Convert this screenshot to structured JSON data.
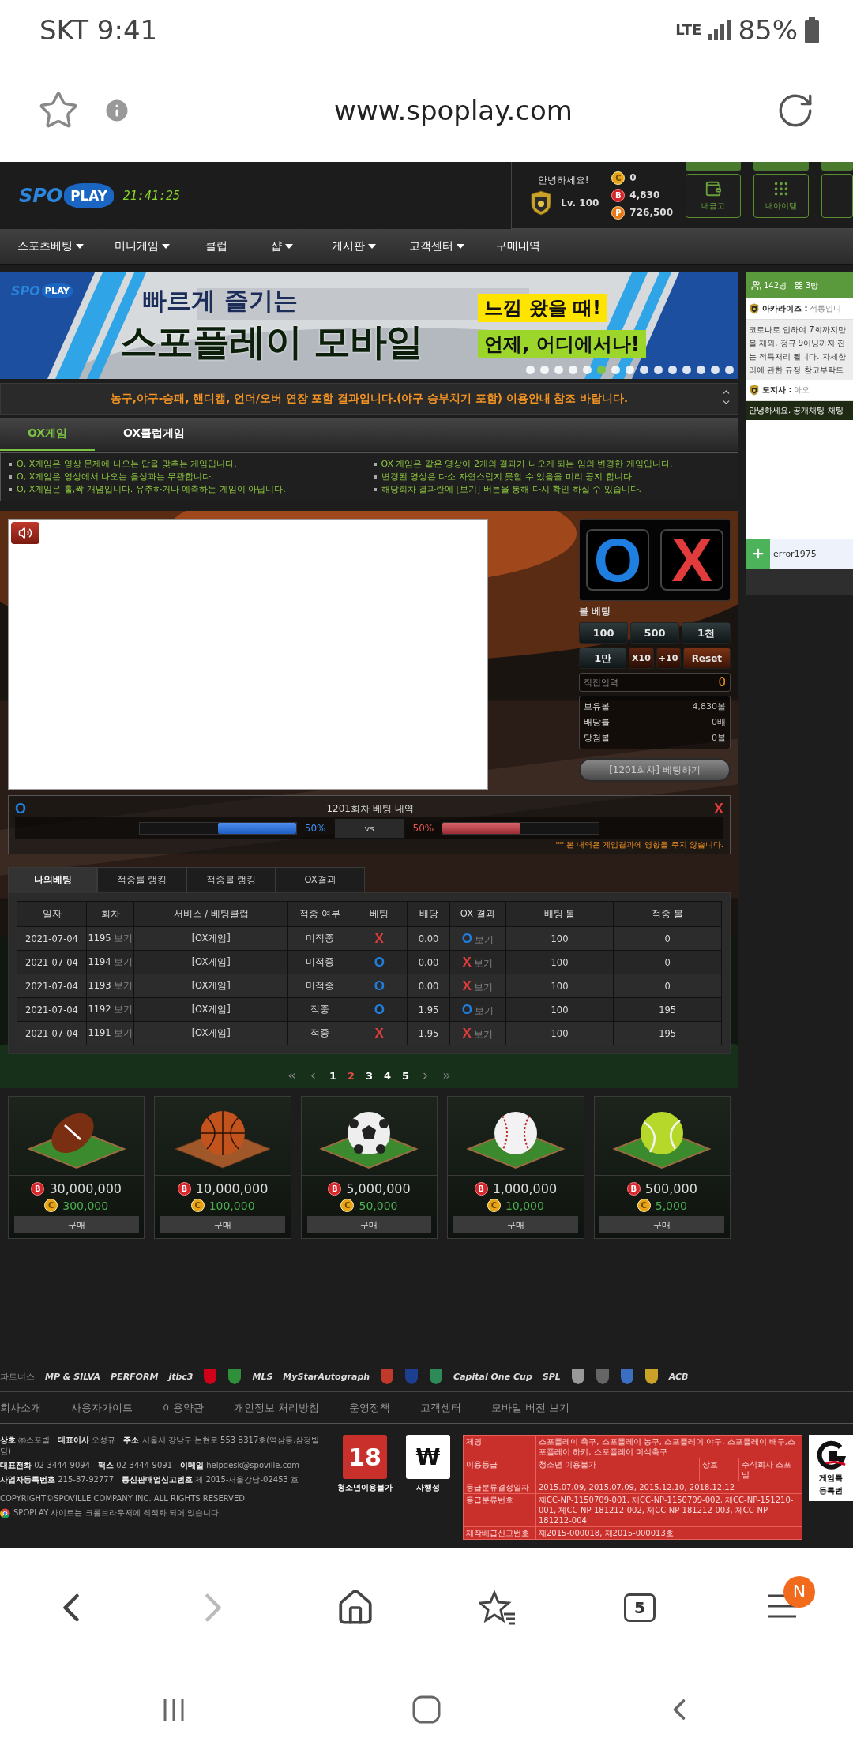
{
  "status_bar": {
    "carrier_time": "SKT 9:41",
    "network": "LTE",
    "battery": "85%"
  },
  "browser": {
    "url": "www.spoplay.com",
    "forward_disabled": true,
    "open_tabs": "5",
    "menu_badge": "N"
  },
  "header": {
    "logo": {
      "part_1": "SPO",
      "part_2": "PLAY"
    },
    "clock": "21:41:25",
    "greeting": "안녕하세요!",
    "level": "Lv. 100",
    "balances": [
      {
        "kind": "coin",
        "symbol": "C",
        "value": "0"
      },
      {
        "kind": "ball",
        "symbol": "B",
        "value": "4,830"
      },
      {
        "kind": "point",
        "symbol": "P",
        "value": "726,500"
      }
    ],
    "buttons": [
      {
        "kind": "wallet",
        "label": "내금고"
      },
      {
        "kind": "items",
        "label": "내아이템"
      }
    ]
  },
  "nav": [
    {
      "label": "스포츠베팅",
      "dropdown": true
    },
    {
      "label": "미니게임",
      "dropdown": true
    },
    {
      "label": "클럽",
      "dropdown": false
    },
    {
      "label": "샵",
      "dropdown": true
    },
    {
      "label": "게시판",
      "dropdown": true
    },
    {
      "label": "고객센터",
      "dropdown": true
    },
    {
      "label": "구매내역",
      "dropdown": false
    }
  ],
  "banner": {
    "logo": {
      "part_1": "SPO",
      "part_2": "PLAY"
    },
    "line_1": "빠르게 즐기는",
    "line_2": "스포플레이 모바일",
    "tag_1": "느낌 왔을 때!",
    "tag_2": "언제, 어디에서나!",
    "dots": [
      {
        "selected": false
      },
      {
        "selected": false
      },
      {
        "selected": false
      },
      {
        "selected": false
      },
      {
        "selected": false
      },
      {
        "selected": true
      },
      {
        "selected": false
      },
      {
        "selected": false
      },
      {
        "selected": false
      },
      {
        "selected": false
      },
      {
        "selected": false
      },
      {
        "selected": false
      },
      {
        "selected": false
      },
      {
        "selected": false
      },
      {
        "selected": false
      }
    ]
  },
  "notice": "농구,야구-승패, 핸디캡, 언더/오버 연장 포함 결과입니다.(야구 승부치기 포함) 이용안내 참조 바랍니다.",
  "game_tabs": [
    {
      "label": "OX게임",
      "selected": true
    },
    {
      "label": "OX클럽게임",
      "selected": false
    }
  ],
  "rules": {
    "left": [
      "O, X게임은 영상 문제에 나오는 답을 맞추는 게임입니다.",
      "O, X게임은 영상에서 나오는 음성과는 무관합니다.",
      "O, X게임은 홀,짝 개념입니다. 유추하거나 예측하는 게임이 아닙니다."
    ],
    "right": [
      "OX 게임은 같은 영상이 2개의 결과가 나오게 되는 임의 변경한 게임입니다.",
      "변경된 영상은 다소 자연스럽지 못할 수 있음을 미리 공지 합니다.",
      "해당회차 결과란에 [보기] 버튼을 통해 다시 확인 하실 수 있습니다."
    ]
  },
  "bet_panel": {
    "choices": [
      {
        "kind": "o",
        "label": "O"
      },
      {
        "kind": "x",
        "label": "X"
      }
    ],
    "title": "볼 베팅",
    "chips": [
      {
        "kind": "amount",
        "label": "100"
      },
      {
        "kind": "amount",
        "label": "500"
      },
      {
        "kind": "amount",
        "label": "1천"
      },
      {
        "kind": "amount",
        "label": "1만"
      },
      {
        "kind": "modifier",
        "label": "X10"
      },
      {
        "kind": "modifier",
        "label": "÷10"
      },
      {
        "kind": "reset",
        "label": "Reset"
      }
    ],
    "direct_input": {
      "label": "직접입력",
      "value": "0"
    },
    "stats": [
      {
        "label": "보유볼",
        "value": "4,830볼"
      },
      {
        "label": "배당률",
        "value": "0배"
      },
      {
        "label": "당첨볼",
        "value": "0볼"
      }
    ],
    "submit": "[1201회차] 베팅하기"
  },
  "history": {
    "title": "1201회차 베팅 내역",
    "left": {
      "label": "O",
      "percent": "50%",
      "level": 0.5
    },
    "vs": "vs",
    "right": {
      "label": "X",
      "percent": "50%",
      "level": 0.5
    },
    "note": "** 본 내역은 게임결과에 영향을 주지 않습니다."
  },
  "record_tabs": [
    {
      "label": "나의베팅",
      "selected": true
    },
    {
      "label": "적중률 랭킹",
      "selected": false
    },
    {
      "label": "적중볼 랭킹",
      "selected": false
    },
    {
      "label": "OX결과",
      "selected": false
    }
  ],
  "table": {
    "columns": [
      "일자",
      "회차",
      "서비스 / 베팅클럽",
      "적중 여부",
      "베팅",
      "배당",
      "OX 결과",
      "배팅 볼",
      "적중 볼"
    ],
    "rows": [
      {
        "date": "2021-07-04",
        "round": "1195",
        "view": "보기",
        "service": "[OX게임]",
        "hit": "미적중",
        "bet": {
          "kind": "x",
          "label": "X"
        },
        "odds": "0.00",
        "result": {
          "kind": "o",
          "label": "O"
        },
        "result_view": "보기",
        "bet_ball": "100",
        "won_ball": "0"
      },
      {
        "date": "2021-07-04",
        "round": "1194",
        "view": "보기",
        "service": "[OX게임]",
        "hit": "미적중",
        "bet": {
          "kind": "o",
          "label": "O"
        },
        "odds": "0.00",
        "result": {
          "kind": "x",
          "label": "X"
        },
        "result_view": "보기",
        "bet_ball": "100",
        "won_ball": "0"
      },
      {
        "date": "2021-07-04",
        "round": "1193",
        "view": "보기",
        "service": "[OX게임]",
        "hit": "미적중",
        "bet": {
          "kind": "o",
          "label": "O"
        },
        "odds": "0.00",
        "result": {
          "kind": "x",
          "label": "X"
        },
        "result_view": "보기",
        "bet_ball": "100",
        "won_ball": "0"
      },
      {
        "date": "2021-07-04",
        "round": "1192",
        "view": "보기",
        "service": "[OX게임]",
        "hit": "적중",
        "bet": {
          "kind": "o",
          "label": "O"
        },
        "odds": "1.95",
        "result": {
          "kind": "o",
          "label": "O"
        },
        "result_view": "보기",
        "bet_ball": "100",
        "won_ball": "195"
      },
      {
        "date": "2021-07-04",
        "round": "1191",
        "view": "보기",
        "service": "[OX게임]",
        "hit": "적중",
        "bet": {
          "kind": "x",
          "label": "X"
        },
        "odds": "1.95",
        "result": {
          "kind": "x",
          "label": "X"
        },
        "result_view": "보기",
        "bet_ball": "100",
        "won_ball": "195"
      }
    ]
  },
  "pagination": [
    {
      "label": "1",
      "selected": false
    },
    {
      "label": "2",
      "selected": true
    },
    {
      "label": "3",
      "selected": false
    },
    {
      "label": "4",
      "selected": false
    },
    {
      "label": "5",
      "selected": false
    }
  ],
  "products": [
    {
      "kind": "football",
      "price_symbol": "B",
      "price": "30,000,000",
      "coin_symbol": "C",
      "coin": "300,000",
      "button": "구매"
    },
    {
      "kind": "basketball",
      "price_symbol": "B",
      "price": "10,000,000",
      "coin_symbol": "C",
      "coin": "100,000",
      "button": "구매"
    },
    {
      "kind": "soccer",
      "price_symbol": "B",
      "price": "5,000,000",
      "coin_symbol": "C",
      "coin": "50,000",
      "button": "구매"
    },
    {
      "kind": "baseball",
      "price_symbol": "B",
      "price": "1,000,000",
      "coin_symbol": "C",
      "coin": "10,000",
      "button": "구매"
    },
    {
      "kind": "tennis",
      "price_symbol": "B",
      "price": "500,000",
      "coin_symbol": "C",
      "coin": "5,000",
      "button": "구매"
    }
  ],
  "footer": {
    "partners_label": "파트너스",
    "partners": [
      {
        "kind": "text",
        "label": "MP & SILVA"
      },
      {
        "kind": "text",
        "label": "PERFORM"
      },
      {
        "kind": "text",
        "label": "jtbc3"
      },
      {
        "kind": "emblem",
        "color": "#d0021b"
      },
      {
        "kind": "emblem",
        "color": "#2f8f3a"
      },
      {
        "kind": "text",
        "label": "MLS"
      },
      {
        "kind": "text",
        "label": "MyStarAutograph"
      },
      {
        "kind": "emblem",
        "color": "#c0392b"
      },
      {
        "kind": "emblem",
        "color": "#1d3f8f"
      },
      {
        "kind": "emblem",
        "color": "#2e8b57"
      },
      {
        "kind": "text",
        "label": "Capital One Cup"
      },
      {
        "kind": "text",
        "label": "SPL"
      },
      {
        "kind": "emblem",
        "color": "#999999"
      },
      {
        "kind": "emblem",
        "color": "#666666"
      },
      {
        "kind": "emblem",
        "color": "#3a6fc4"
      },
      {
        "kind": "emblem",
        "color": "#c9a227"
      },
      {
        "kind": "text",
        "label": "ACB"
      }
    ],
    "links": [
      "회사소개",
      "사용자가이드",
      "이용약관",
      "개인정보 처리방침",
      "운영정책",
      "고객센터",
      "모바일 버전 보기"
    ],
    "info": [
      [
        {
          "label": "상호",
          "value": "㈜스포빌"
        },
        {
          "label": "대표이사",
          "value": "오성규"
        },
        {
          "label": "주소",
          "value": "서울시 강남구 논현로 553 B317호(역삼동,삼정빌딩)"
        }
      ],
      [
        {
          "label": "대표전화",
          "value": "02-3444-9094"
        },
        {
          "label": "팩스",
          "value": "02-3444-9091"
        },
        {
          "label": "이메일",
          "value": "helpdesk@spoville.com"
        }
      ],
      [
        {
          "label": "사업자등록번호",
          "value": "215-87-92777"
        },
        {
          "label": "통신판매업신고번호",
          "value": "제 2015-서울강남-02453 호"
        }
      ]
    ],
    "copyright": "COPYRIGHT©SPOVILLE COMPANY INC. ALL RIGHTS RESERVED",
    "browser_note": "SPOPLAY 사이트는 크롬브라우저에 최적화 되어 있습니다.",
    "age_badge": {
      "mark": "18",
      "label": "청소년이용불가"
    },
    "gambling_badge": {
      "mark": "₩",
      "label": "사행성"
    },
    "rating": [
      {
        "label": "제명",
        "value": "스포플레이 축구, 스포플레이 농구, 스포플레이 야구, 스포플레이 배구,스포플레이 하키, 스포플레이 미식축구"
      },
      {
        "label": "이용등급",
        "value": "청소년 이용불가",
        "extra_label": "상호",
        "extra_value": "주식회사 스포빌"
      },
      {
        "label": "등급분류결정일자",
        "value": "2015.07.09, 2015.07.09, 2015.12.10, 2018.12.12"
      },
      {
        "label": "등급분류번호",
        "value": "제CC-NP-1150709-001, 제CC-NP-1150709-002, 제CC-NP-151210-001, 제CC-NP-181212-002, 제CC-NP-181212-003, 제CC-NP-181212-004"
      },
      {
        "label": "제작배급신고번호",
        "value": "제2015-000018, 제2015-000013호"
      }
    ],
    "registration": [
      "게임특",
      "등록번"
    ]
  },
  "chat": {
    "users": "142명",
    "rooms": "3방",
    "messages": [
      {
        "kind": "user",
        "user": "아카라이즈 :",
        "text": "적통임니"
      },
      {
        "kind": "notice",
        "lines": [
          "코로나로 인하여 7회까지만",
          "을 제외, 정규 9이닝까지 진",
          "는 적특처리 됩니다. 자세한",
          "리에 관한 규정 참고부탁드"
        ]
      },
      {
        "kind": "user",
        "user": "도지사 :",
        "text": "아오"
      },
      {
        "kind": "system",
        "text": "안녕하세요. 공개채팅 채팅"
      }
    ],
    "input": "error1975"
  }
}
